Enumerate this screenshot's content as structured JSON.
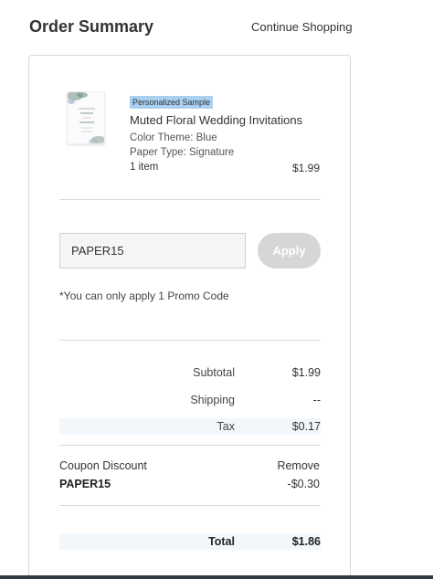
{
  "header": {
    "title": "Order Summary",
    "continue_link": "Continue Shopping"
  },
  "item": {
    "badge": "Personalized Sample",
    "name": "Muted Floral Wedding Invitations",
    "color_theme": "Color Theme: Blue",
    "paper_type": "Paper Type: Signature",
    "quantity": "1 item",
    "price": "$1.99",
    "thumbnail_icon": "wedding-invitation-thumbnail"
  },
  "promo": {
    "input_value": "PAPER15",
    "apply_label": "Apply",
    "note": "*You can only apply 1 Promo Code"
  },
  "summary": {
    "subtotal_label": "Subtotal",
    "subtotal_value": "$1.99",
    "shipping_label": "Shipping",
    "shipping_value": "--",
    "tax_label": "Tax",
    "tax_value": "$0.17",
    "total_label": "Total",
    "total_value": "$1.86"
  },
  "coupon": {
    "label": "Coupon Discount",
    "code": "PAPER15",
    "remove_label": "Remove",
    "amount": "-$0.30"
  },
  "colors": {
    "badge_bg": "#a9cff1",
    "shaded_row": "#f2f7fc",
    "apply_disabled": "#d6d6d6"
  }
}
